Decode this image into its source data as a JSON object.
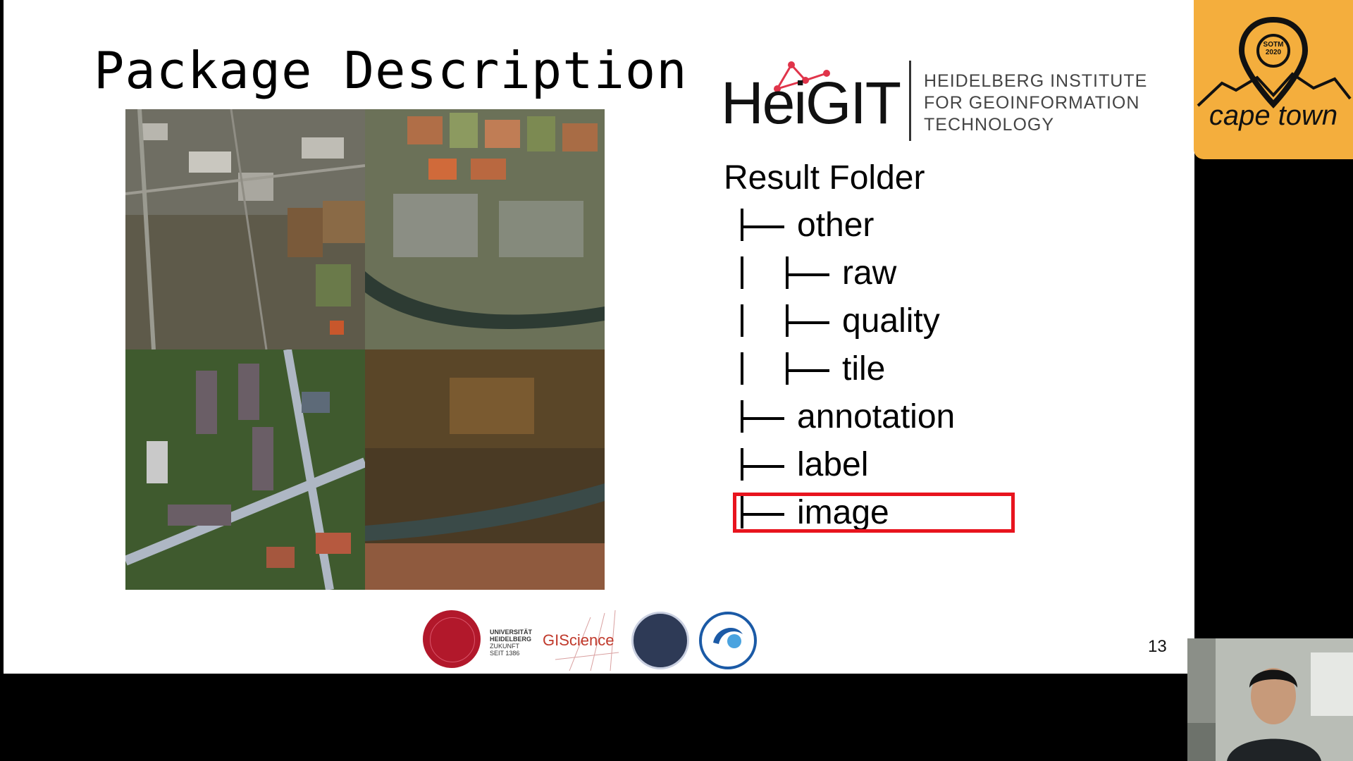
{
  "slide": {
    "title": "Package Description",
    "page_number": "13"
  },
  "heigit": {
    "wordmark": "HeiGIT",
    "line1": "HEIDELBERG INSTITUTE",
    "line2": "FOR GEOINFORMATION",
    "line3": "TECHNOLOGY"
  },
  "tree": {
    "title": "Result Folder",
    "items": [
      {
        "label": "other",
        "level": 1
      },
      {
        "label": "raw",
        "level": 2
      },
      {
        "label": "quality",
        "level": 2
      },
      {
        "label": "tile",
        "level": 2
      },
      {
        "label": "annotation",
        "level": 1
      },
      {
        "label": "label",
        "level": 1
      },
      {
        "label": "image",
        "level": 1
      }
    ],
    "highlighted": "image",
    "highlight_color": "#e8141e"
  },
  "logos": {
    "uni_name": "UNIVERSITÄT",
    "uni_city": "HEIDELBERG",
    "uni_motto": "ZUKUNFT",
    "uni_since": "SEIT 1386",
    "giscience": "GIScience"
  },
  "sotm": {
    "event": "SOTM",
    "year": "2020",
    "city": "cape town",
    "color": "#f4ae3d"
  }
}
